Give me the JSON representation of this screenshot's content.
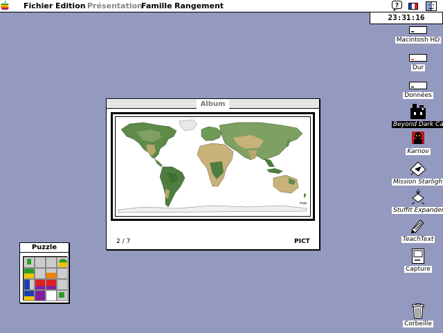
{
  "menubar": {
    "apple_icon": "apple-icon",
    "items": [
      {
        "label": "Fichier",
        "enabled": true
      },
      {
        "label": "Edition",
        "enabled": true
      },
      {
        "label": "Présentation",
        "enabled": false
      },
      {
        "label": "Famille",
        "enabled": true
      },
      {
        "label": "Rangement",
        "enabled": true
      }
    ],
    "help_icon": "help-balloon-icon",
    "keyboard_icon": "french-flag-icon",
    "app_icon": "finder-icon"
  },
  "clock": {
    "time": "23:31:16"
  },
  "desktop_icons": [
    {
      "label": "Macintosh HD",
      "icon": "hard-disk-icon"
    },
    {
      "label": "Dur",
      "icon": "hard-disk-icon"
    },
    {
      "label": "Données",
      "icon": "hard-disk-icon"
    },
    {
      "label": "Beyond Dark Castle",
      "icon": "castle-icon",
      "selected": true
    },
    {
      "label": "Karnov",
      "icon": "karnov-icon"
    },
    {
      "label": "Mission Starlight",
      "icon": "starlight-icon"
    },
    {
      "label": "StuffIt Expander™",
      "icon": "stuffit-icon"
    },
    {
      "label": "TeachText",
      "icon": "teachtext-icon"
    },
    {
      "label": "Capture",
      "icon": "capture-icon"
    },
    {
      "label": "Corbeille",
      "icon": "trash-icon"
    }
  ],
  "album": {
    "title": "Album",
    "counter": "2 / 7",
    "type": "PICT",
    "image": "world-map-image",
    "signature": "mac"
  },
  "puzzle": {
    "title": "Puzzle"
  },
  "colors": {
    "desktop": "#9499c0",
    "ocean": "#ffffff",
    "land_green": "#4f7d3f",
    "land_tan": "#c8b27a"
  }
}
